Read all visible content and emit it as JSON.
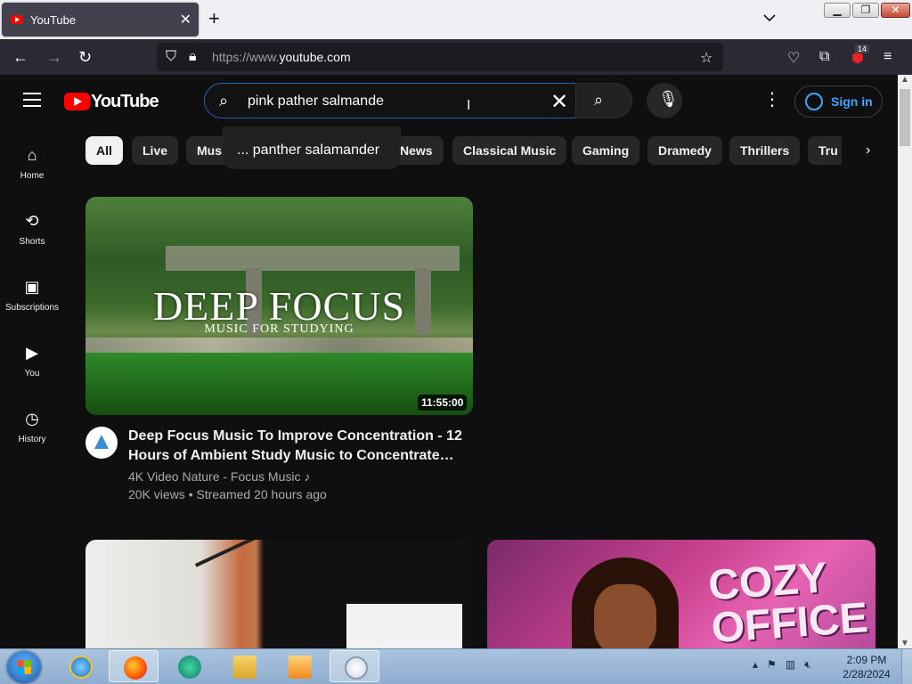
{
  "browser": {
    "tab_title": "YouTube",
    "tab_close": "✕",
    "new_tab": "+",
    "url_prefix": "https://www.",
    "url_host": "youtube.com",
    "extension_badge": "14"
  },
  "youtube": {
    "logo_text": "YouTube",
    "search_value": "pink pather salmande",
    "suggestion": "... panther salamander",
    "sign_in": "Sign in"
  },
  "sidebar": {
    "items": [
      {
        "label": "Home"
      },
      {
        "label": "Shorts"
      },
      {
        "label": "Subscriptions"
      },
      {
        "label": "You"
      },
      {
        "label": "History"
      }
    ]
  },
  "chips": [
    "All",
    "Live",
    "Mus",
    "News",
    "Classical Music",
    "Gaming",
    "Dramedy",
    "Thrillers",
    "Tru"
  ],
  "videos": [
    {
      "thumb_title": "DEEP FOCUS",
      "thumb_subtitle": "MUSIC FOR STUDYING",
      "duration": "11:55:00",
      "title": "Deep Focus Music To Improve Concentration - 12 Hours of Ambient Study Music to Concentrate…",
      "channel": "4K Video Nature - Focus Music ♪",
      "meta": "20K views • Streamed 20 hours ago"
    },
    {
      "thumb_title": ""
    },
    {
      "thumb_title": "COZY OFFICE"
    }
  ],
  "taskbar": {
    "time": "2:09 PM",
    "date": "2/28/2024"
  },
  "colors": {
    "accent": "#3ea6ff",
    "youtube_red": "#ff0000",
    "background": "#0f0f0f"
  }
}
